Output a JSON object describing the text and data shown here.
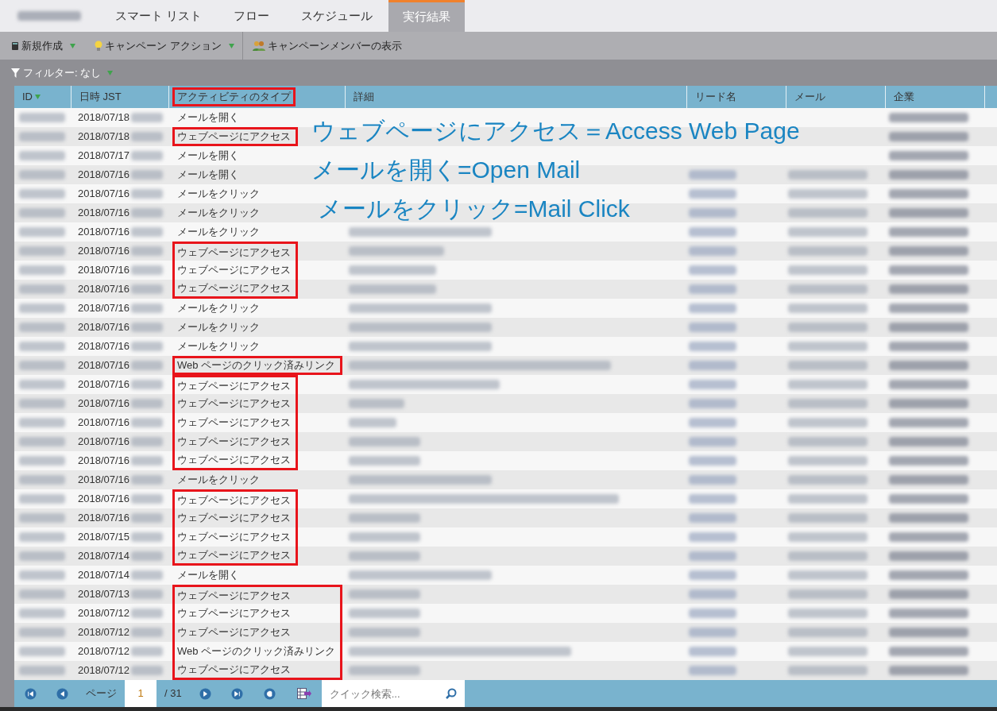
{
  "tabs": [
    {
      "label": "スマート リスト",
      "selected": false
    },
    {
      "label": "フロー",
      "selected": false
    },
    {
      "label": "スケジュール",
      "selected": false
    },
    {
      "label": "実行結果",
      "selected": true
    }
  ],
  "toolbar": [
    {
      "label": "新規作成",
      "kind": "document",
      "dropdown": true
    },
    {
      "label": "キャンペーン アクション",
      "kind": "bulb",
      "dropdown": true
    },
    {
      "label": "キャンペーンメンバーの表示",
      "kind": "people",
      "dropdown": false
    }
  ],
  "filter": {
    "label": "フィルター: なし"
  },
  "table": {
    "columns": [
      {
        "label": "ID",
        "sorted": true,
        "outlined": false
      },
      {
        "label": "日時 JST",
        "sorted": false,
        "outlined": false
      },
      {
        "label": "アクティビティのタイプ",
        "sorted": false,
        "outlined": true
      },
      {
        "label": "詳細",
        "sorted": false,
        "outlined": false
      },
      {
        "label": "リード名",
        "sorted": false,
        "outlined": false
      },
      {
        "label": "メール",
        "sorted": false,
        "outlined": false
      },
      {
        "label": "企業",
        "sorted": false,
        "outlined": false
      }
    ],
    "row_groups": [
      {
        "outlined": false,
        "rows": [
          {
            "date": "2018/07/18",
            "activity": "メールを開く"
          }
        ]
      },
      {
        "outlined": true,
        "rows": [
          {
            "date": "2018/07/18",
            "activity": "ウェブページにアクセス"
          }
        ]
      },
      {
        "outlined": false,
        "rows": [
          {
            "date": "2018/07/17",
            "activity": "メールを開く"
          },
          {
            "date": "2018/07/16",
            "activity": "メールを開く"
          },
          {
            "date": "2018/07/16",
            "activity": "メールをクリック"
          },
          {
            "date": "2018/07/16",
            "activity": "メールをクリック"
          },
          {
            "date": "2018/07/16",
            "activity": "メールをクリック"
          }
        ]
      },
      {
        "outlined": true,
        "rows": [
          {
            "date": "2018/07/16",
            "activity": "ウェブページにアクセス"
          },
          {
            "date": "2018/07/16",
            "activity": "ウェブページにアクセス"
          },
          {
            "date": "2018/07/16",
            "activity": "ウェブページにアクセス"
          }
        ]
      },
      {
        "outlined": false,
        "rows": [
          {
            "date": "2018/07/16",
            "activity": "メールをクリック"
          },
          {
            "date": "2018/07/16",
            "activity": "メールをクリック"
          },
          {
            "date": "2018/07/16",
            "activity": "メールをクリック"
          }
        ]
      },
      {
        "outlined": true,
        "rows": [
          {
            "date": "2018/07/16",
            "activity": "Web ページのクリック済みリンク"
          }
        ]
      },
      {
        "outlined": true,
        "rows": [
          {
            "date": "2018/07/16",
            "activity": "ウェブページにアクセス"
          },
          {
            "date": "2018/07/16",
            "activity": "ウェブページにアクセス"
          },
          {
            "date": "2018/07/16",
            "activity": "ウェブページにアクセス"
          },
          {
            "date": "2018/07/16",
            "activity": "ウェブページにアクセス"
          },
          {
            "date": "2018/07/16",
            "activity": "ウェブページにアクセス"
          }
        ]
      },
      {
        "outlined": false,
        "rows": [
          {
            "date": "2018/07/16",
            "activity": "メールをクリック"
          }
        ]
      },
      {
        "outlined": true,
        "rows": [
          {
            "date": "2018/07/16",
            "activity": "ウェブページにアクセス"
          },
          {
            "date": "2018/07/16",
            "activity": "ウェブページにアクセス"
          },
          {
            "date": "2018/07/15",
            "activity": "ウェブページにアクセス"
          },
          {
            "date": "2018/07/14",
            "activity": "ウェブページにアクセス"
          }
        ]
      },
      {
        "outlined": false,
        "rows": [
          {
            "date": "2018/07/14",
            "activity": "メールを開く"
          }
        ]
      },
      {
        "outlined": true,
        "rows": [
          {
            "date": "2018/07/13",
            "activity": "ウェブページにアクセス"
          },
          {
            "date": "2018/07/12",
            "activity": "ウェブページにアクセス"
          },
          {
            "date": "2018/07/12",
            "activity": "ウェブページにアクセス"
          },
          {
            "date": "2018/07/12",
            "activity": "Web ページのクリック済みリンク"
          },
          {
            "date": "2018/07/12",
            "activity": "ウェブページにアクセス"
          }
        ]
      }
    ]
  },
  "annotations": [
    "ウェブページにアクセス＝Access Web Page",
    "メールを開く=Open Mail",
    "メールをクリック=Mail Click"
  ],
  "pager": {
    "label": "ページ",
    "page": "1",
    "total": "/ 31",
    "search_placeholder": "クイック検索..."
  }
}
